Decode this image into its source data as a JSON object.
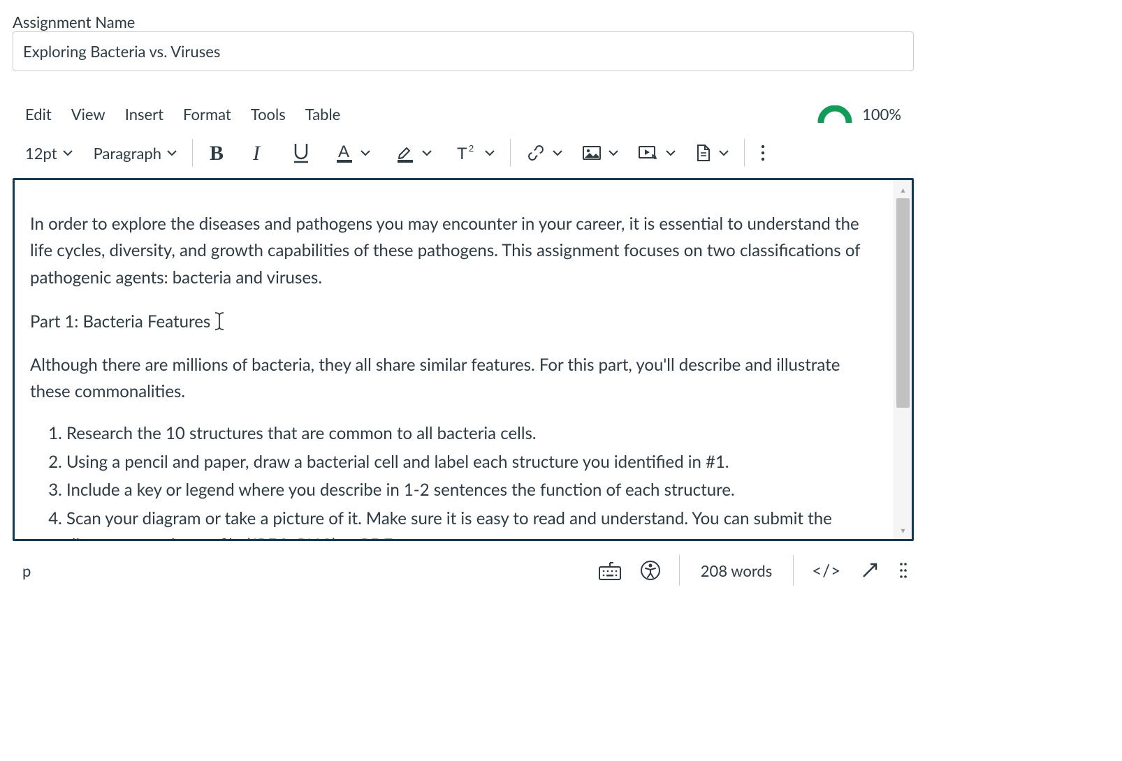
{
  "assignment": {
    "name_label": "Assignment Name",
    "name_value": "Exploring Bacteria vs. Viruses"
  },
  "menu": {
    "edit": "Edit",
    "view": "View",
    "insert": "Insert",
    "format": "Format",
    "tools": "Tools",
    "table": "Table",
    "completeness": "100%"
  },
  "toolbar": {
    "font_size": "12pt",
    "block_style": "Paragraph"
  },
  "content": {
    "p1": "In order to explore the diseases and pathogens you may encounter in your career, it is essential to understand the life cycles, diversity, and growth capabilities of these pathogens. This assignment focuses on two classifications of pathogenic agents: bacteria and viruses.",
    "p2": "Part 1: Bacteria Features",
    "p3": "Although there are millions of bacteria, they all share similar features. For this part, you'll describe and illustrate these commonalities.",
    "li1": "Research the 10 structures that are common to all bacteria cells.",
    "li2": "Using a pencil and paper, draw a bacterial cell and label each structure you identified in #1.",
    "li3": "Include a key or legend where you describe in 1-2 sentences the function of each structure.",
    "li4": "Scan your diagram or take a picture of it. Make sure it is easy to read and understand. You can submit the diagram as an image file (JPEG, PNG) or PDF."
  },
  "status": {
    "path": "p",
    "word_count": "208 words",
    "html_toggle": "</>"
  }
}
